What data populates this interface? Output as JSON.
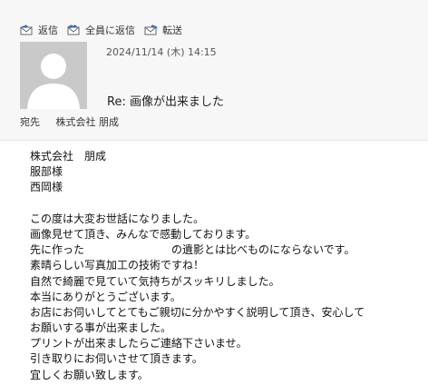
{
  "toolbar": {
    "reply_label": "返信",
    "reply_all_label": "全員に返信",
    "forward_label": "転送"
  },
  "message": {
    "datetime": "2024/11/14 (木) 14:15",
    "subject": "Re: 画像が出来ました",
    "to_label": "宛先",
    "to_value": "株式会社 朋成"
  },
  "body": {
    "lines": [
      "株式会社　朋成",
      "服部様",
      "西岡様",
      "",
      "この度は大変お世話になりました。",
      "画像見せて頂き、みんなで感動しております。",
      "の遺影とは比べものにならないです。",
      "素晴らしい写真加工の技術ですね！",
      "自然で綺麗で見ていて気持ちがスッキリしました。",
      "本当にありがとうございます。",
      "お店にお伺いしてとてもご親切に分かやすく説明して頂き、安心して",
      "お願いする事が出来ました。",
      "プリントが出来ましたらご連絡下さいませ。",
      "引き取りにお伺いさせて頂きます。",
      "宜しくお願い致します。"
    ],
    "line7_prefix": "先に作った"
  },
  "colors": {
    "header_bg": "#f7f7f7",
    "avatar_bg": "#c9c9c9",
    "icon_blue": "#3b6db5"
  }
}
